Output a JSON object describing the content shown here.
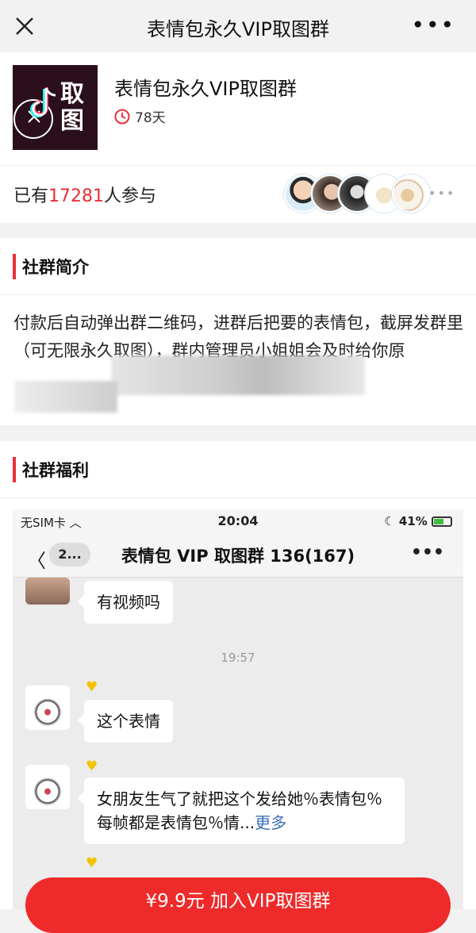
{
  "topbar": {
    "title": "表情包永久VIP取图群",
    "more": "•••"
  },
  "group": {
    "name": "表情包永久VIP取图群",
    "duration": "78天",
    "logo_text": "取图"
  },
  "join": {
    "prefix": "已有",
    "count": "17281",
    "suffix": "人参与"
  },
  "intro": {
    "title": "社群简介",
    "text": "付款后自动弹出群二维码，进群后把要的表情包，截屏发群里（可无限永久取图），群内管理员小姐姐会及时给你原"
  },
  "benefit": {
    "title": "社群福利"
  },
  "phone": {
    "carrier": "无SIM卡",
    "clock": "20:04",
    "battery": "41%",
    "back_label": "2...",
    "chat_title": "表情包 VIP 取图群 136(167)",
    "msg1": "有视频吗",
    "time": "19:57",
    "msg2": "这个表情",
    "msg3": "女朋友生气了就把这个发给她％表情包％每帧都是表情包％情...",
    "msg3_more": "更多"
  },
  "cta": {
    "label": "¥9.9元 加入VIP取图群"
  },
  "colors": {
    "accent": "#e8303a",
    "button": "#ee2a2a"
  }
}
